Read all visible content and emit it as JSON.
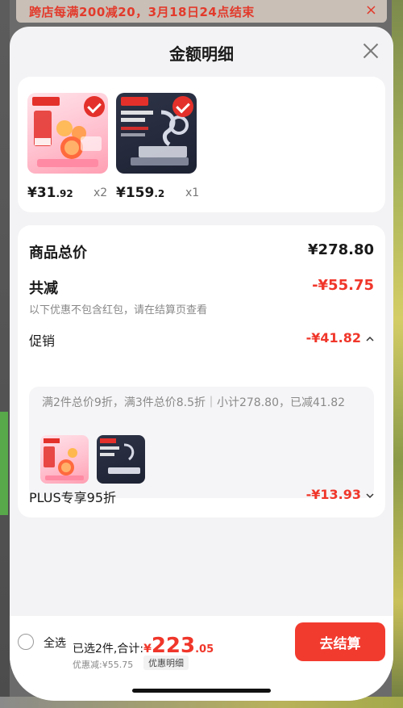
{
  "banner": {
    "text": "跨店每满200减20，3月18日24点结束",
    "close_glyph": "×"
  },
  "sheet": {
    "title": "金额明细"
  },
  "products": [
    {
      "price_int": "¥31",
      "price_dec": ".92",
      "qty": "x2"
    },
    {
      "price_int": "¥159",
      "price_dec": ".2",
      "qty": "x1"
    }
  ],
  "details": {
    "total_label": "商品总价",
    "total_value": "¥278.80",
    "reduce_label": "共减",
    "reduce_value": "-¥55.75",
    "reduce_note": "以下优惠不包含红包，请在结算页查看",
    "promo_label": "促销",
    "promo_value": "-¥41.82",
    "promo_detail": "满2件总价9折，满3件总价8.5折｜小计278.80，已减41.82",
    "plus_label": "PLUS专享95折",
    "plus_value": "-¥13.93"
  },
  "bottom": {
    "select_all": "全选",
    "selected_text": "已选2件,合计:",
    "total_symbol": "¥",
    "total_int": "223",
    "total_dec": ".05",
    "discount": "优惠减:¥55.75",
    "detail_chip": "优惠明细",
    "checkout": "去结算"
  },
  "colors": {
    "accent": "#f0362a",
    "button": "#f23b2f"
  },
  "icons": [
    "close-icon",
    "check-icon",
    "chevron-up-icon",
    "chevron-down-icon",
    "radio-unchecked-icon"
  ]
}
